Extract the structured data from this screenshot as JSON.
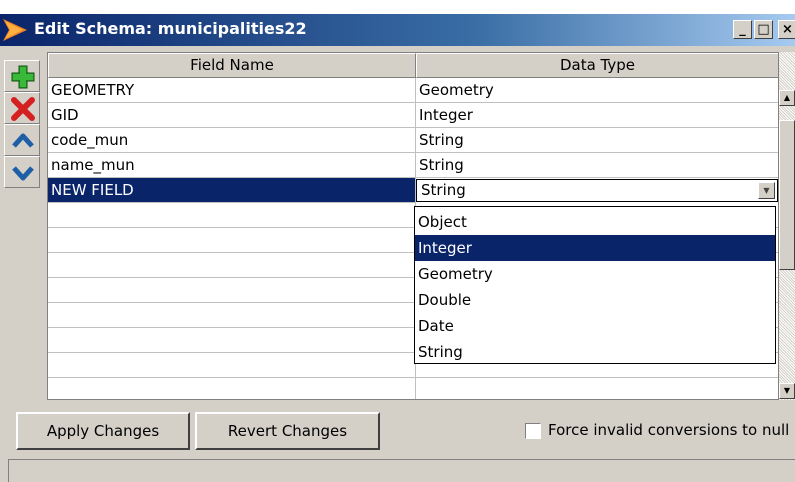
{
  "window": {
    "title": "Edit Schema: municipalities22",
    "controls": {
      "minimize": "_",
      "maximize": "□",
      "close": "×"
    }
  },
  "toolstrip": {
    "items": [
      {
        "name": "add-field",
        "icon": "plus-icon",
        "color": "#2e9e2e"
      },
      {
        "name": "delete-field",
        "icon": "x-icon",
        "color": "#d42020"
      },
      {
        "name": "move-up",
        "icon": "chevron-up-icon",
        "color": "#1f5fa8"
      },
      {
        "name": "move-down",
        "icon": "chevron-down-icon",
        "color": "#1f5fa8"
      }
    ]
  },
  "table": {
    "columns": [
      "Field Name",
      "Data Type"
    ],
    "rows": [
      {
        "field": "GEOMETRY",
        "type": "Geometry"
      },
      {
        "field": "GID",
        "type": "Integer"
      },
      {
        "field": "code_mun",
        "type": "String"
      },
      {
        "field": "name_mun",
        "type": "String"
      },
      {
        "field": "NEW FIELD",
        "type": "String"
      }
    ],
    "selected_row": 4
  },
  "dropdown": {
    "current": "String",
    "options": [
      "Object",
      "Integer",
      "Geometry",
      "Double",
      "Date",
      "String"
    ],
    "highlighted": "Integer"
  },
  "buttons": {
    "apply": "Apply Changes",
    "revert": "Revert Changes"
  },
  "force_null": {
    "label": "Force invalid conversions to null",
    "checked": false
  },
  "colors": {
    "title_bar": "#0a246a",
    "selection": "#0a246a",
    "chrome": "#d4d0c8"
  }
}
